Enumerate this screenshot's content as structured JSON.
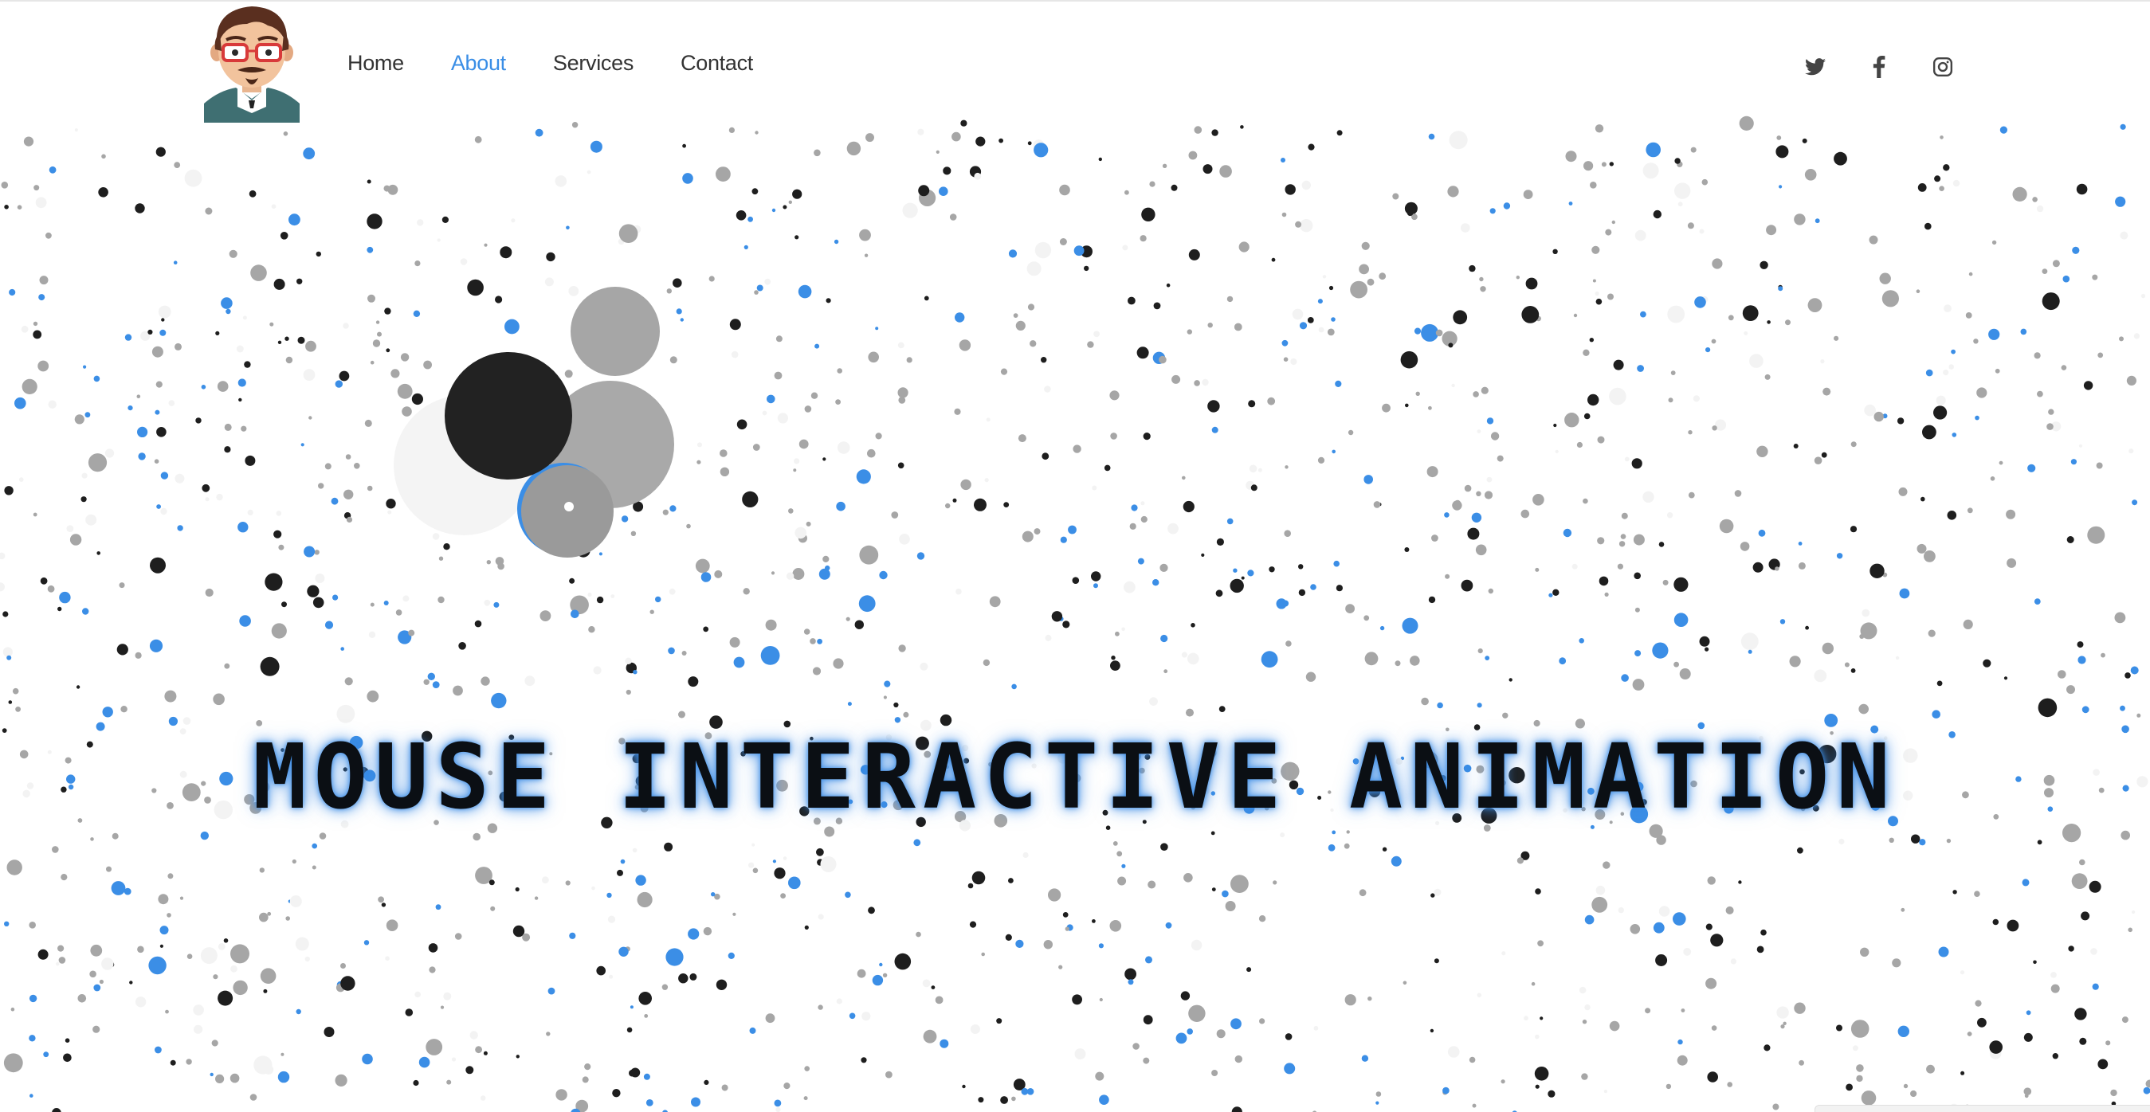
{
  "header": {
    "avatar_alt": "Cartoon avatar of man with red glasses and goatee",
    "nav": [
      {
        "label": "Home",
        "active": false
      },
      {
        "label": "About",
        "active": true
      },
      {
        "label": "Services",
        "active": false
      },
      {
        "label": "Contact",
        "active": false
      }
    ],
    "social": [
      "twitter-icon",
      "facebook-icon",
      "instagram-icon"
    ]
  },
  "hero": {
    "title": "MOUSE INTERACTIVE ANIMATION"
  },
  "colors": {
    "accent": "#3a8ee6",
    "particle_blue": "#3b8ee6",
    "particle_black": "#1e1e1e",
    "particle_gray": "#a6a6a6",
    "particle_light": "#f3f3f3",
    "nav_text": "#333333",
    "title_glow": "#3c8ce6"
  }
}
